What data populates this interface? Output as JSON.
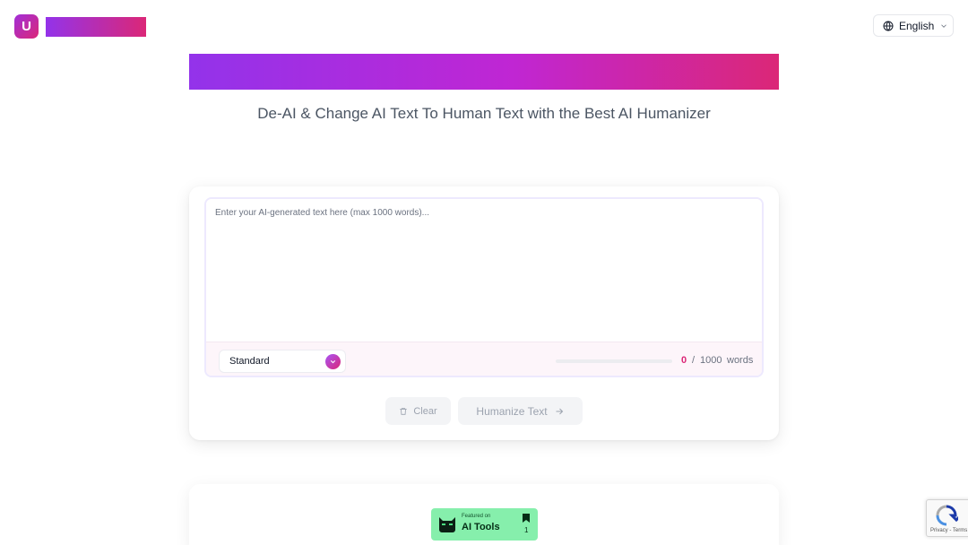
{
  "header": {
    "logo_letter": "U",
    "language": "English"
  },
  "hero": {
    "subtitle": "De-AI & Change AI Text To Human Text with the Best AI Humanizer"
  },
  "editor": {
    "placeholder": "Enter your AI-generated text here (max 1000 words)...",
    "value": "",
    "mode": "Standard",
    "word_count": "0",
    "separator": "/",
    "word_limit": "1000",
    "unit": "words",
    "progress_fraction": 0
  },
  "actions": {
    "clear_label": "Clear",
    "humanize_label": "Humanize Text"
  },
  "featured": {
    "small_text": "Featured on",
    "title": "AI Tools",
    "count": "1"
  },
  "recaptcha": {
    "links": "Privacy - Terms"
  },
  "colors": {
    "brand_purple": "#9333ea",
    "brand_pink": "#db2777",
    "featured_green": "#86efac"
  }
}
